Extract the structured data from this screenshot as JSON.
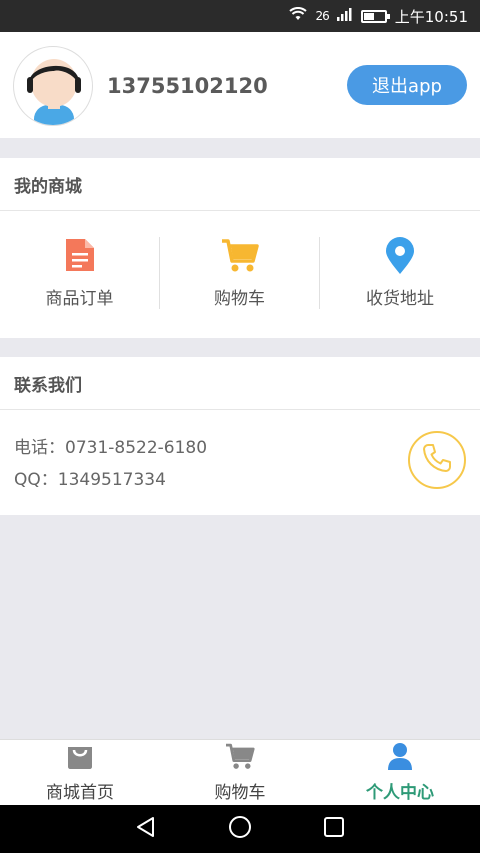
{
  "status_bar": {
    "network": "26",
    "time": "上午10:51"
  },
  "profile": {
    "phone": "13755102120",
    "logout_label": "退出app"
  },
  "mall": {
    "title": "我的商城",
    "items": [
      {
        "label": "商品订单",
        "icon": "order-document-icon",
        "color": "#f4785a"
      },
      {
        "label": "购物车",
        "icon": "cart-icon",
        "color": "#f7b731"
      },
      {
        "label": "收货地址",
        "icon": "location-pin-icon",
        "color": "#3ba0ea"
      }
    ]
  },
  "contact": {
    "title": "联系我们",
    "phone_line": "电话：0731-8522-6180",
    "qq_line": "QQ：1349517334",
    "call_icon": "phone-call-icon",
    "call_color": "#f6c84b"
  },
  "tabbar": {
    "tabs": [
      {
        "label": "商城首页",
        "icon": "shopping-bag-icon",
        "active": false
      },
      {
        "label": "购物车",
        "icon": "cart-icon",
        "active": false
      },
      {
        "label": "个人中心",
        "icon": "person-icon",
        "active": true
      }
    ],
    "active_color": "#2e9a77"
  }
}
